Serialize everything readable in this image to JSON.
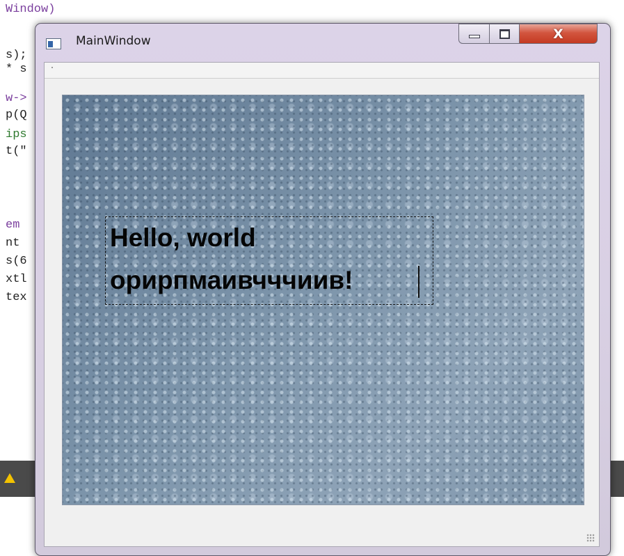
{
  "background_editor": {
    "lines": [
      {
        "text": "Window)",
        "color": "#7b3f9e"
      },
      {
        "text": "s);",
        "color": "#222222"
      },
      {
        "text": "* s",
        "color": "#222222"
      },
      {
        "text": "w->",
        "color": "#7b3f9e"
      },
      {
        "text": "p(Q",
        "color": "#222222"
      },
      {
        "text": "ips",
        "color": "#2f7a2f"
      },
      {
        "text": "t(\"",
        "color": "#222222"
      },
      {
        "text": "em",
        "color": "#7b3f9e"
      },
      {
        "text": "nt",
        "color": "#222222"
      },
      {
        "text": "s(6",
        "color": "#222222"
      },
      {
        "text": "xtl",
        "color": "#222222"
      },
      {
        "text": "tex",
        "color": "#222222"
      }
    ]
  },
  "window": {
    "title": "MainWindow",
    "icon": "app-window-icon",
    "controls": {
      "minimize": "minimize-icon",
      "maximize": "maximize-icon",
      "close_glyph": "X"
    }
  },
  "canvas": {
    "text_item": {
      "line1": "Hello, world",
      "line2": "орирпмаивчччиив!"
    }
  },
  "colors": {
    "frame_tint": "#d9d0e4",
    "close_red": "#c43a22",
    "canvas_blue": "#6e879f"
  }
}
